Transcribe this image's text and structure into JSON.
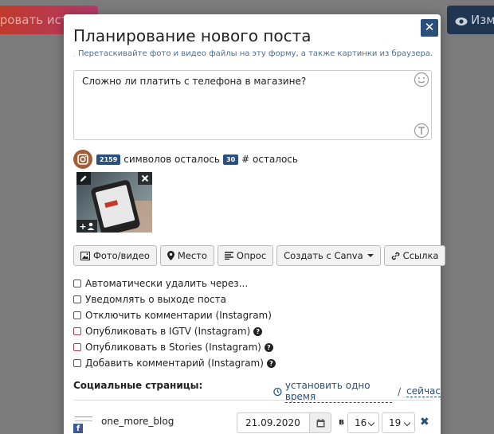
{
  "background": {
    "left_button_label": "ировать истор",
    "right_button_label": "Изме"
  },
  "modal": {
    "title": "Планирование нового поста",
    "close_label": "✕",
    "hint": "Перетаскивайте фото и видео файлы на эту форму, а также картинки из браузера.",
    "post_text": "Сложно ли платить с телефона в магазине?"
  },
  "counters": {
    "chars_left": "2159",
    "chars_left_label": "символов осталось",
    "hashtags_left": "30",
    "hashtags_left_label": "# осталось"
  },
  "media": {
    "add_user_label": "+"
  },
  "toolbar": {
    "photo_video": "Фото/видео",
    "place": "Место",
    "poll": "Опрос",
    "canva": "Создать с Canva",
    "link": "Ссылка"
  },
  "options": [
    {
      "label": "Автоматически удалить через...",
      "checked": false,
      "help": false,
      "highlight": false
    },
    {
      "label": "Уведомлять о выходе поста",
      "checked": false,
      "help": false,
      "highlight": false
    },
    {
      "label": "Отключить комментарии (Instagram)",
      "checked": false,
      "help": false,
      "highlight": false
    },
    {
      "label": "Опубликовать в IGTV (Instagram)",
      "checked": false,
      "help": true,
      "highlight": true
    },
    {
      "label": "Опубликовать в Stories (Instagram)",
      "checked": false,
      "help": true,
      "highlight": true
    },
    {
      "label": "Добавить комментарий (Instagram)",
      "checked": false,
      "help": true,
      "highlight": false
    }
  ],
  "social": {
    "title": "Социальные страницы:",
    "set_one_time": "установить одно время",
    "separator": "/",
    "now": "сейчас"
  },
  "account": {
    "name": "one_more_blog",
    "date": "21.09.2020",
    "at_label": "в",
    "hour": "16",
    "minute": "19",
    "remove_label": "✖"
  },
  "colors": {
    "accent": "#2a4f7a",
    "highlight_checkbox": "#b3364a",
    "instagram_icon": "#a0603a",
    "facebook": "#3b5998"
  }
}
